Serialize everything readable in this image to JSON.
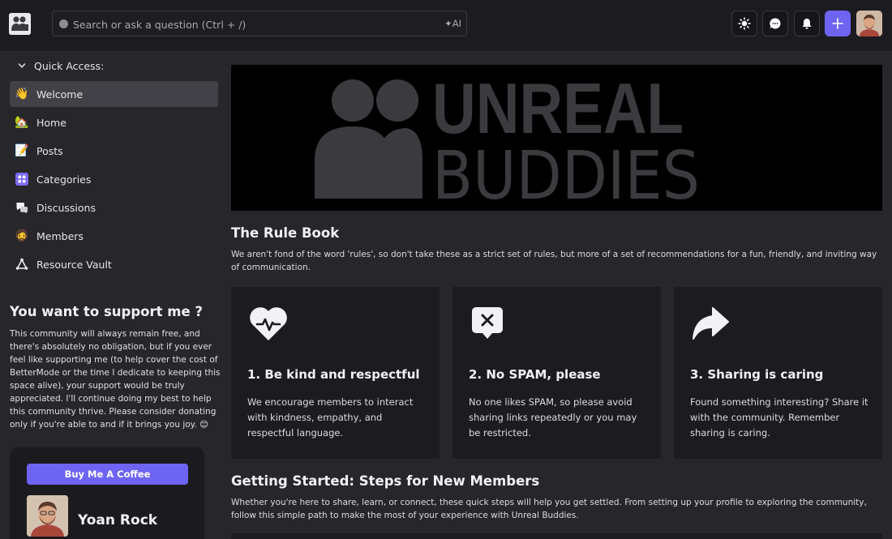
{
  "topbar": {
    "search_placeholder": "Search or ask a question (Ctrl + /)",
    "ai_label": "✦AI",
    "icons": [
      "sun-icon",
      "chat-icon",
      "bell-icon",
      "plus-icon"
    ],
    "accent": "#6d64f2"
  },
  "sidebar": {
    "quick_access_label": "Quick Access:",
    "items": [
      {
        "label": "Welcome",
        "icon": "👋",
        "active": true
      },
      {
        "label": "Home",
        "icon": "🏡"
      },
      {
        "label": "Posts",
        "icon": "📝"
      },
      {
        "label": "Categories",
        "icon": "grid-icon"
      },
      {
        "label": "Discussions",
        "icon": "chat-bubbles-icon"
      },
      {
        "label": "Members",
        "icon": "🧔"
      },
      {
        "label": "Resource Vault",
        "icon": "triangle-nodes-icon"
      }
    ]
  },
  "support": {
    "title": "You want to support me ?",
    "text": "This community will always remain free, and there's absolutely no obligation, but if you ever feel like supporting me (to help cover the cost of BetterMode or the time I dedicate to keeping this space alive), your support would be truly appreciated. I'll continue doing my best to help this community thrive. Please consider donating only if you're able to and if it brings you joy. 😊",
    "button_label": "Buy Me A Coffee",
    "name": "Yoan Rock"
  },
  "banner": {
    "line1": "UNREAL",
    "line2": "BUDDIES"
  },
  "rulebook": {
    "title": "The Rule Book",
    "intro": "We aren't fond of the word 'rules', so don't take these as a strict set of rules, but more of a set of recommendations for a fun, friendly, and inviting way of communication.",
    "cards": [
      {
        "title": "1. Be kind and respectful",
        "text": "We encourage members to interact with kindness, empathy, and respectful language.",
        "icon": "heart-pulse-icon"
      },
      {
        "title": "2. No SPAM, please",
        "text": "No one likes SPAM, so please avoid sharing links repeatedly or you may be restricted.",
        "icon": "no-spam-icon"
      },
      {
        "title": "3. Sharing is caring",
        "text": "Found something interesting? Share it with the community. Remember sharing is caring.",
        "icon": "share-arrow-icon"
      }
    ]
  },
  "getting_started": {
    "title": "Getting Started: Steps for New Members",
    "intro": "Whether you're here to share, learn, or connect, these quick steps will help you get settled. From setting up your profile to exploring the community, follow this simple path to make the most of your experience with Unreal Buddies."
  }
}
